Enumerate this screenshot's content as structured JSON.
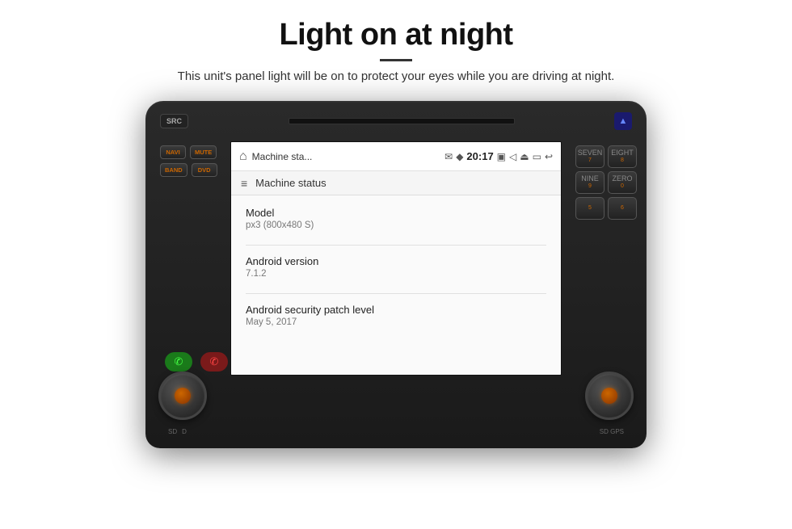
{
  "page": {
    "title": "Light on at night",
    "divider": true,
    "subtitle": "This unit's panel light will be on to protect your eyes while you are driving at night."
  },
  "device": {
    "top_button": "SRC",
    "alert_button": "▲",
    "left_buttons": [
      {
        "label": "NAVI",
        "row": 0
      },
      {
        "label": "MUTE",
        "row": 0
      },
      {
        "label": "BAND",
        "row": 1
      },
      {
        "label": "DVD",
        "row": 1
      }
    ],
    "right_buttons": [
      {
        "top_label": "SEVEN",
        "num": "7"
      },
      {
        "top_label": "EIGHT",
        "num": "8"
      },
      {
        "top_label": "NINE",
        "num": "9"
      },
      {
        "top_label": "ZERO",
        "num": "0"
      },
      {
        "top_label": "5",
        "num": "5"
      },
      {
        "top_label": "6",
        "num": "6"
      }
    ],
    "sd_left": "SD",
    "sd_right": "SD GPS"
  },
  "android_screen": {
    "status_bar": {
      "home_icon": "⌂",
      "app_title": "Machine sta...",
      "message_icon": "✉",
      "location_icon": "♦",
      "time": "20:17",
      "camera_icon": "▣",
      "volume_icon": "◁",
      "eject_icon": "⏏",
      "cast_icon": "▭",
      "back_icon": "↩"
    },
    "nav_bar": {
      "menu_icon": "≡",
      "title": "Machine status"
    },
    "content": {
      "sections": [
        {
          "label": "Model",
          "value": "px3 (800x480 S)"
        },
        {
          "label": "Android version",
          "value": "7.1.2"
        },
        {
          "label": "Android security patch level",
          "value": "May 5, 2017"
        }
      ]
    }
  }
}
